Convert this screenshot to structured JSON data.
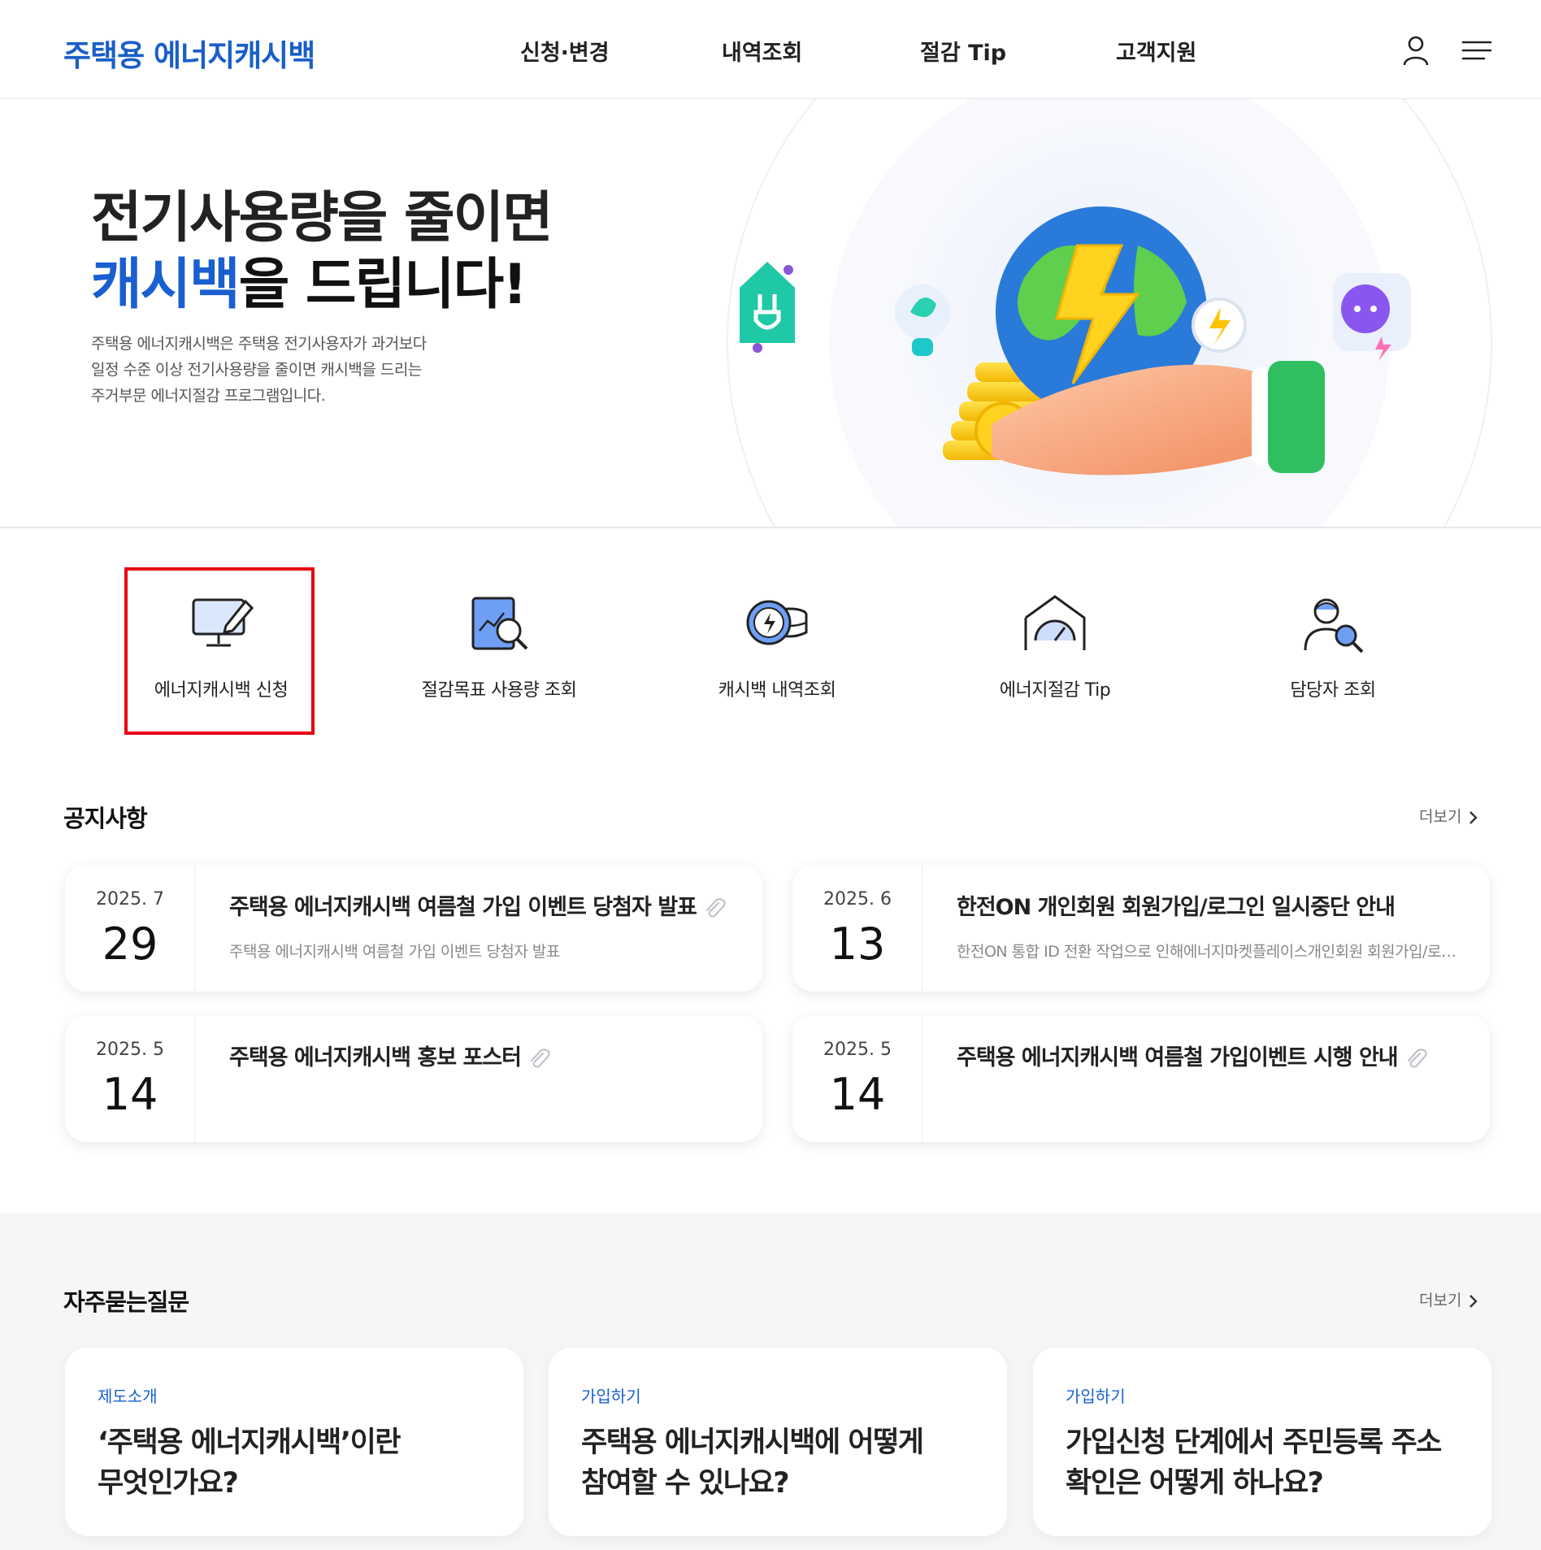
{
  "header": {
    "logo": "주택용 에너지캐시백",
    "nav": [
      "신청·변경",
      "내역조회",
      "절감 Tip",
      "고객지원"
    ],
    "icons": [
      "user-icon",
      "hamburger-menu-icon"
    ]
  },
  "hero": {
    "title_line1": "전기사용량을 줄이면",
    "title_accent": "캐시백",
    "title_line2_rest": "을 드립니다!",
    "desc_lines": [
      "주택용 에너지캐시백은 주택용 전기사용자가 과거보다",
      "일정 수준 이상 전기사용량을 줄이면 캐시백을 드리는",
      "주거부문 에너지절감 프로그램입니다."
    ]
  },
  "quick_menu": [
    {
      "label": "에너지캐시백 신청",
      "icon": "monitor-pen-icon"
    },
    {
      "label": "절감목표 사용량 조회",
      "icon": "report-search-icon"
    },
    {
      "label": "캐시백 내역조회",
      "icon": "coin-lightning-icon"
    },
    {
      "label": "에너지절감 Tip",
      "icon": "house-gauge-icon"
    },
    {
      "label": "담당자 조회",
      "icon": "person-search-icon"
    }
  ],
  "notice": {
    "title": "공지사항",
    "more": "더보기",
    "items": [
      {
        "ym": "2025. 7",
        "day": "29",
        "title": "주택용 에너지캐시백 여름철 가입 이벤트 당첨자 발표",
        "summary": "주택용 에너지캐시백 여름철 가입 이벤트 당첨자 발표",
        "attachment": true
      },
      {
        "ym": "2025. 6",
        "day": "13",
        "title": "한전ON 개인회원 회원가입/로그인 일시중단 안내",
        "summary": "한전ON 통합 ID 전환 작업으로 인해에너지마켓플레이스개인회원 회원가입/로그인 일시중단",
        "attachment": false
      },
      {
        "ym": "2025. 5",
        "day": "14",
        "title": "주택용 에너지캐시백 홍보 포스터",
        "summary": "",
        "attachment": true
      },
      {
        "ym": "2025. 5",
        "day": "14",
        "title": "주택용 에너지캐시백 여름철 가입이벤트 시행 안내",
        "summary": "",
        "attachment": true
      }
    ]
  },
  "faq": {
    "title": "자주묻는질문",
    "more": "더보기",
    "items": [
      {
        "category": "제도소개",
        "q1": "‘주택용 에너지캐시백’이란",
        "q2": "무엇인가요?"
      },
      {
        "category": "가입하기",
        "q1": "주택용 에너지캐시백에 어떻게",
        "q2": "참여할 수 있나요?"
      },
      {
        "category": "가입하기",
        "q1": "가입신청 단계에서 주민등록 주소",
        "q2": "확인은 어떻게 하나요?"
      }
    ]
  },
  "colors": {
    "brand": "#1a5fc8",
    "accent": "#1a5fd0",
    "highlight": "#e60012",
    "faq_bg": "#f5f6f8"
  }
}
